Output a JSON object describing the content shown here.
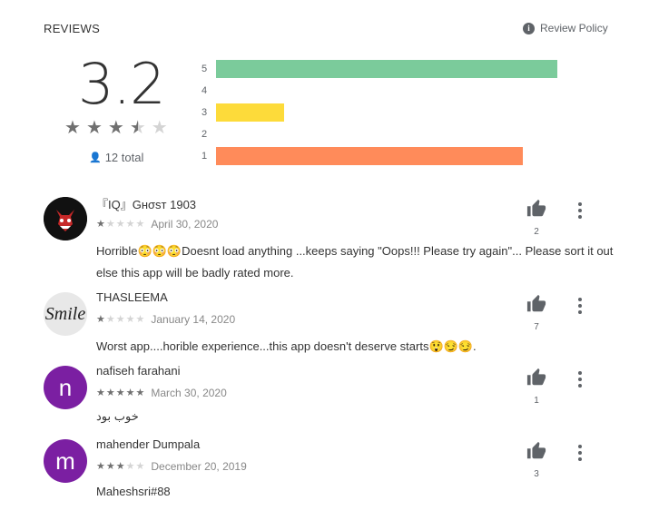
{
  "header": {
    "title": "REVIEWS",
    "policy_label": "Review Policy",
    "policy_icon": "info-icon"
  },
  "summary": {
    "score": "3.2",
    "stars_filled": 3,
    "stars_half": 1,
    "total_label": "12 total",
    "total_icon": "person-icon"
  },
  "distribution": [
    {
      "label": "5",
      "fraction": 0.8,
      "color": "#7bcb9b"
    },
    {
      "label": "4",
      "fraction": 0.0,
      "color": "#b6d983"
    },
    {
      "label": "3",
      "fraction": 0.16,
      "color": "#fddb3a"
    },
    {
      "label": "2",
      "fraction": 0.0,
      "color": "#fbbc55"
    },
    {
      "label": "1",
      "fraction": 0.72,
      "color": "#ff8b5a"
    }
  ],
  "colors": {
    "star_filled": "#707070",
    "star_empty": "#d4d4d4"
  },
  "reviews": [
    {
      "name": "『IQ』Gнσѕт 1903",
      "stars": 1,
      "date": "April 30, 2020",
      "text": "Horrible😳😳😳Doesnt load anything ...keeps saying \"Oops!!! Please try again\"... Please sort it out else this app will be badly rated more.",
      "likes": "2",
      "avatar_letter": "",
      "avatar_color": "#111111",
      "avatar_icon": "demon-avatar-icon"
    },
    {
      "name": "THASLEEMA",
      "stars": 1,
      "date": "January 14, 2020",
      "text": "Worst app....horible experience...this app doesn't deserve starts😲😏😏.",
      "likes": "7",
      "avatar_letter": "Smile",
      "avatar_color": "#e8e8e8",
      "avatar_icon": ""
    },
    {
      "name": "nafiseh farahani",
      "stars": 5,
      "date": "March 30, 2020",
      "text": "خوب بود",
      "likes": "1",
      "avatar_letter": "n",
      "avatar_color": "#7b1fa2",
      "avatar_icon": ""
    },
    {
      "name": "mahender Dumpala",
      "stars": 3,
      "date": "December 20, 2019",
      "text": "Maheshsri#88",
      "likes": "3",
      "avatar_letter": "m",
      "avatar_color": "#7b1fa2",
      "avatar_icon": ""
    }
  ]
}
